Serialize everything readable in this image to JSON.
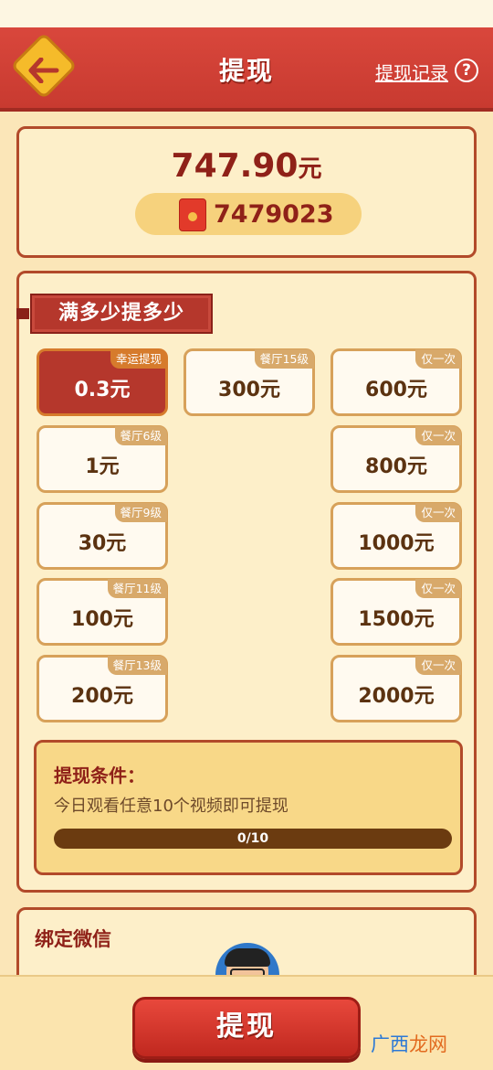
{
  "header": {
    "title": "提现",
    "records_label": "提现记录",
    "help_label": "?"
  },
  "balance": {
    "amount": "747.90",
    "unit": "元",
    "coins": "7479023"
  },
  "section_label": "满多少提多少",
  "options": [
    {
      "tag": "幸运提现",
      "amount": "0.3元",
      "selected": true
    },
    {
      "tag": "餐厅15级",
      "amount": "300元"
    },
    {
      "tag": "仅一次",
      "amount": "600元"
    },
    {
      "tag": "餐厅6级",
      "amount": "1元"
    },
    {
      "tag": "仅一次",
      "amount": "800元"
    },
    {
      "tag": "餐厅9级",
      "amount": "30元"
    },
    {
      "tag": "仅一次",
      "amount": "1000元"
    },
    {
      "tag": "餐厅11级",
      "amount": "100元"
    },
    {
      "tag": "仅一次",
      "amount": "1500元"
    },
    {
      "tag": "餐厅13级",
      "amount": "200元"
    },
    {
      "tag": "仅一次",
      "amount": "2000元"
    }
  ],
  "condition": {
    "title": "提现条件：",
    "text": "今日观看任意10个视频即可提现",
    "progress_label": "0/10",
    "progress_fraction": 0
  },
  "bind_wechat": {
    "title": "绑定微信"
  },
  "bottom": {
    "withdraw_label": "提现",
    "watermark_a": "广西",
    "watermark_b": "龙网"
  },
  "colors": {
    "header_red": "#c83a30",
    "card_bg": "#fdefc9",
    "accent_gold": "#f5bb2a"
  }
}
